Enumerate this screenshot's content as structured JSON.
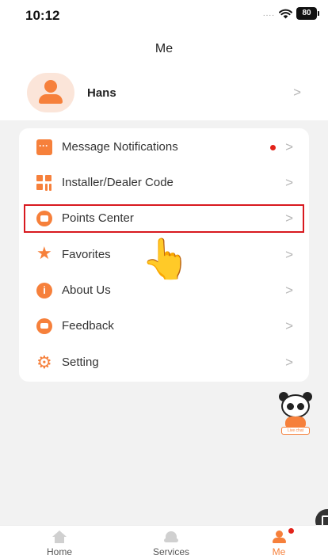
{
  "status_bar": {
    "time": "10:12",
    "signal": "....",
    "wifi": "wifi",
    "battery": "80"
  },
  "header": {
    "title": "Me"
  },
  "profile": {
    "name": "Hans",
    "chevron": ">"
  },
  "menu": {
    "items": [
      {
        "label": "Message Notifications",
        "icon": "message-icon",
        "unread": true,
        "chevron": ">"
      },
      {
        "label": "Installer/Dealer Code",
        "icon": "qr-code-icon",
        "chevron": ">"
      },
      {
        "label": "Points Center",
        "icon": "points-icon",
        "chevron": ">",
        "highlighted": true
      },
      {
        "label": "Favorites",
        "icon": "star-icon",
        "chevron": ">"
      },
      {
        "label": "About Us",
        "icon": "info-icon",
        "chevron": ">"
      },
      {
        "label": "Feedback",
        "icon": "feedback-icon",
        "chevron": ">"
      },
      {
        "label": "Setting",
        "icon": "gear-icon",
        "chevron": ">"
      }
    ]
  },
  "overlay": {
    "pointer": "pointing-hand-icon",
    "highlight_color": "#d8191f"
  },
  "live_chat": {
    "label": "Live chat"
  },
  "tabbar": {
    "tabs": [
      {
        "label": "Home",
        "icon": "home-icon",
        "active": false
      },
      {
        "label": "Services",
        "icon": "services-icon",
        "active": false
      },
      {
        "label": "Me",
        "icon": "me-icon",
        "active": true,
        "badge": true
      }
    ]
  },
  "colors": {
    "accent": "#f6803b",
    "badge": "#e2231a",
    "background": "#f2f2f2"
  }
}
